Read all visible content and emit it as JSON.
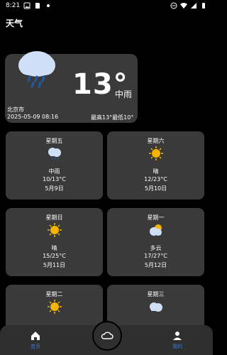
{
  "status_bar": {
    "time": "8:21",
    "left_icons": [
      "image-icon",
      "sim-card-icon",
      "notification-dot-icon"
    ],
    "right_icons": [
      "dnd-icon",
      "wifi-icon",
      "signal-icon",
      "battery-icon"
    ]
  },
  "app": {
    "title": "天气"
  },
  "current": {
    "temperature": "13°",
    "condition": "中雨",
    "city": "北京市",
    "datetime": "2025-05-09 08:16",
    "high_low": "最高13°最低10°",
    "icon": "rain-cloud-icon"
  },
  "forecast": [
    {
      "day": "星期五",
      "icon": "rain-cloud-icon",
      "desc": "中雨",
      "range": "10/13°C",
      "date": "5月9日"
    },
    {
      "day": "星期六",
      "icon": "sun-icon",
      "desc": "晴",
      "range": "12/23°C",
      "date": "5月10日"
    },
    {
      "day": "星期日",
      "icon": "sun-icon",
      "desc": "晴",
      "range": "15/25°C",
      "date": "5月11日"
    },
    {
      "day": "星期一",
      "icon": "partly-cloudy-icon",
      "desc": "多云",
      "range": "17/27°C",
      "date": "5月12日"
    },
    {
      "day": "星期二",
      "icon": "sun-icon",
      "desc": "",
      "range": "",
      "date": ""
    },
    {
      "day": "星期三",
      "icon": "cloud-icon",
      "desc": "",
      "range": "",
      "date": ""
    }
  ],
  "nav": {
    "home_label": "首页",
    "mine_label": "我的"
  },
  "colors": {
    "background": "#000000",
    "card": "#3a3a3a",
    "nav": "#2f2f2f",
    "accent": "#3b7bd6",
    "sun": "#f4b400",
    "cloud": "#cfe0f6",
    "rain": "#1e5aa8"
  }
}
